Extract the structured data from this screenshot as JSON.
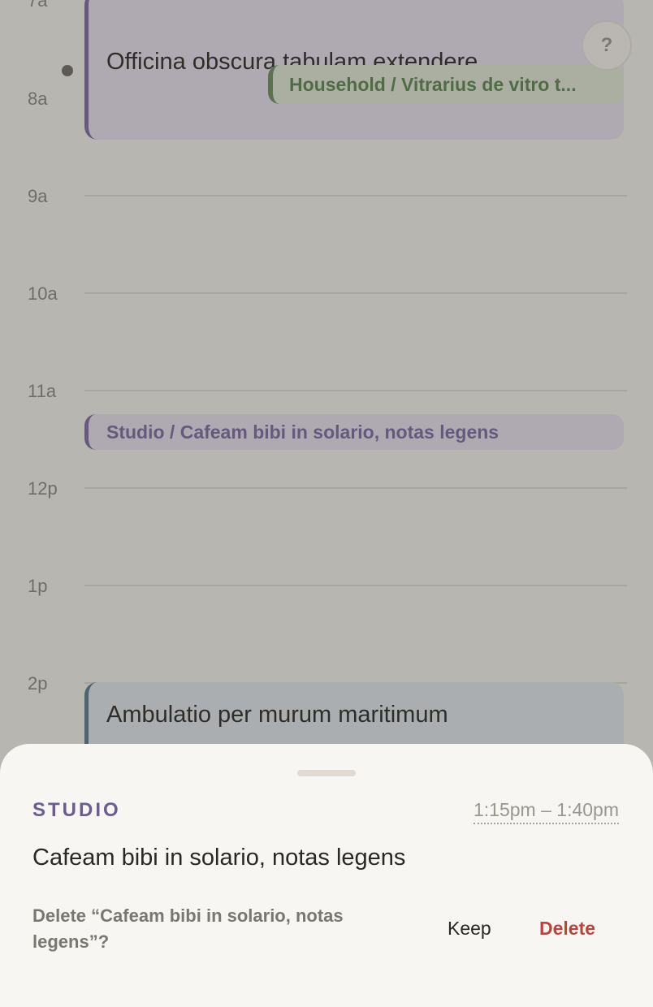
{
  "timeline": {
    "hours": [
      "7a",
      "8a",
      "9a",
      "10a",
      "11a",
      "12p",
      "1p",
      "2p"
    ],
    "events": {
      "officina": {
        "title": "Officina obscura tabulam extendere"
      },
      "household_chip": {
        "label": "Household / Vitrarius de vitro t..."
      },
      "studio_chip": {
        "label": "Studio / Cafeam bibi in solario, notas legens"
      },
      "ambulatio": {
        "title": "Ambulatio per murum maritimum"
      }
    },
    "help_label": "?"
  },
  "sheet": {
    "category": "STUDIO",
    "time_range": "1:15pm – 1:40pm",
    "title": "Cafeam bibi in solario, notas legens",
    "delete_prompt": "Delete “Cafeam bibi in solario, notas legens”?",
    "keep_label": "Keep",
    "delete_label": "Delete"
  },
  "colors": {
    "studio_accent": "#7c6aa3",
    "household_accent": "#6a8c5e",
    "walk_accent": "#5a7890",
    "delete_red": "#b8463f"
  }
}
